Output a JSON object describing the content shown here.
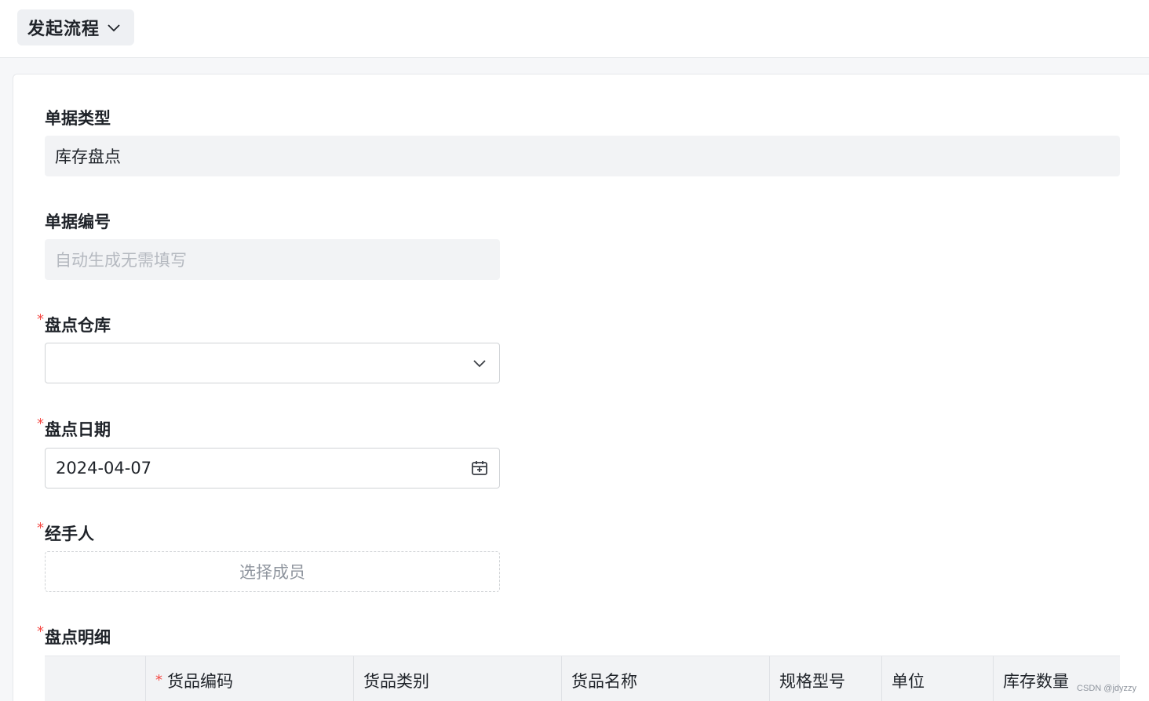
{
  "topbar": {
    "flow_label": "发起流程"
  },
  "form": {
    "doc_type": {
      "label": "单据类型",
      "value": "库存盘点"
    },
    "doc_no": {
      "label": "单据编号",
      "placeholder": "自动生成无需填写"
    },
    "warehouse": {
      "required_mark": "*",
      "label": "盘点仓库",
      "value": ""
    },
    "date": {
      "required_mark": "*",
      "label": "盘点日期",
      "value": "2024-04-07"
    },
    "handler": {
      "required_mark": "*",
      "label": "经手人",
      "button": "选择成员"
    },
    "details": {
      "required_mark": "*",
      "label": "盘点明细",
      "columns": [
        {
          "label": "",
          "required": false
        },
        {
          "label": "货品编码",
          "required": true
        },
        {
          "label": "货品类别",
          "required": false
        },
        {
          "label": "货品名称",
          "required": false
        },
        {
          "label": "规格型号",
          "required": false
        },
        {
          "label": "单位",
          "required": false
        },
        {
          "label": "库存数量",
          "required": false
        }
      ]
    }
  },
  "watermark": "CSDN @jdyzzy",
  "colors": {
    "required": "#f54a45",
    "readonly_bg": "#f2f3f5",
    "border": "#d0d3d6"
  }
}
